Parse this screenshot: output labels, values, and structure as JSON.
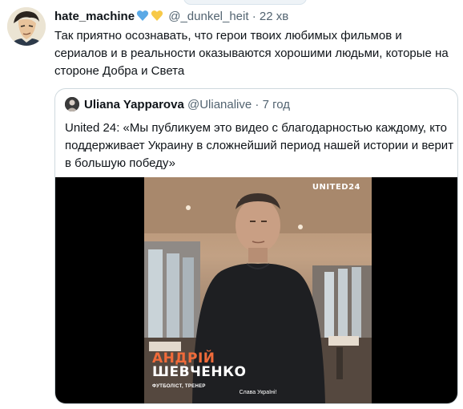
{
  "tweet": {
    "display_name": "hate_machine",
    "handle": "@_dunkel_heit",
    "separator": "·",
    "time": "22 хв",
    "text": "Так приятно осознавать, что герои твоих любимых фильмов и сериалов и в реальности оказываются хорошими людьми, которые на стороне Добра и Света"
  },
  "quoted_tweet": {
    "display_name": "Uliana Yapparova",
    "handle": "@Ulianalive",
    "separator": "·",
    "time": "7 год",
    "text": "United 24: «Мы публикуем это видео с благодарностью каждому, кто поддерживает Украину в сложнейший период нашей истории и верит в большую победу»",
    "video": {
      "logo": "UNITED24",
      "name_line1": "АНДРІЙ",
      "name_line2": "ШЕВЧЕНКО",
      "role": "ФУТБОЛІСТ, ТРЕНЕР",
      "subtitle": "Слава Україні!"
    }
  },
  "colors": {
    "heart_blue": "#5aa9e6",
    "heart_yellow": "#f7c948",
    "name_accent": "#f06b3a"
  }
}
